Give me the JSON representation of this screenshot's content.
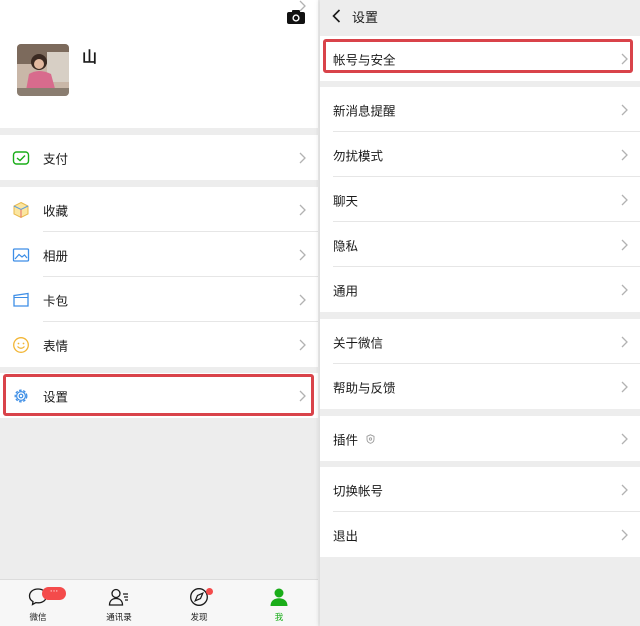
{
  "left": {
    "profile": {
      "name": "山"
    },
    "menu_pay": [
      {
        "label": "支付",
        "icon": "pay-icon"
      }
    ],
    "menu_more": [
      {
        "label": "收藏",
        "icon": "favorites-icon"
      },
      {
        "label": "相册",
        "icon": "album-icon"
      },
      {
        "label": "卡包",
        "icon": "card-wallet-icon"
      },
      {
        "label": "表情",
        "icon": "sticker-icon"
      }
    ],
    "menu_settings": [
      {
        "label": "设置",
        "icon": "gear-icon"
      }
    ],
    "tabbar": [
      {
        "label": "微信",
        "icon": "chat-icon",
        "badge": "···"
      },
      {
        "label": "通讯录",
        "icon": "contacts-icon"
      },
      {
        "label": "发现",
        "icon": "discover-icon"
      },
      {
        "label": "我",
        "icon": "me-icon",
        "active": true
      }
    ]
  },
  "right": {
    "title": "设置",
    "groups": [
      [
        "帐号与安全"
      ],
      [
        "新消息提醒",
        "勿扰模式",
        "聊天",
        "隐私",
        "通用"
      ],
      [
        "关于微信",
        "帮助与反馈"
      ],
      [
        "插件"
      ],
      [
        "切换帐号",
        "退出"
      ]
    ]
  },
  "colors": {
    "highlight": "#d9434a",
    "active_green": "#1aad19",
    "badge_red": "#f44b4b"
  }
}
